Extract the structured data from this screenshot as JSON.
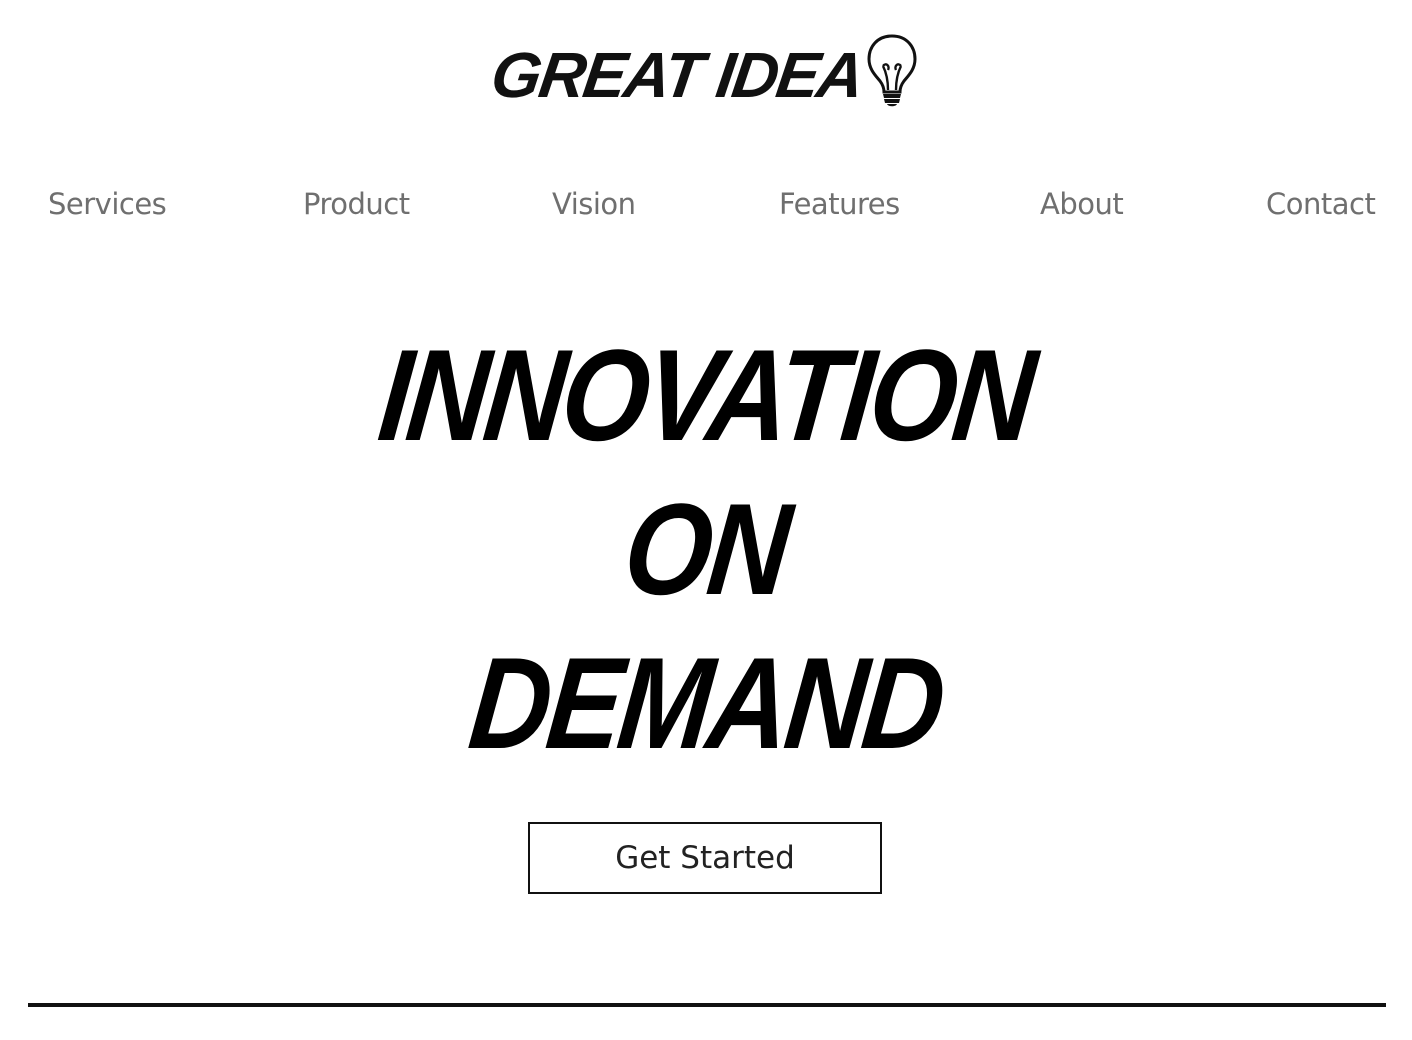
{
  "logo": {
    "text": "GREAT IDEA",
    "icon": "lightbulb-icon"
  },
  "nav": {
    "items": [
      {
        "label": "Services"
      },
      {
        "label": "Product"
      },
      {
        "label": "Vision"
      },
      {
        "label": "Features"
      },
      {
        "label": "About"
      },
      {
        "label": "Contact"
      }
    ]
  },
  "hero": {
    "line1": "INNOVATION",
    "line2": "ON",
    "line3": "DEMAND"
  },
  "cta": {
    "label": "Get Started"
  },
  "colors": {
    "text": "#000000",
    "nav_text": "#6f6f6f",
    "background": "#ffffff",
    "divider": "#111111"
  }
}
